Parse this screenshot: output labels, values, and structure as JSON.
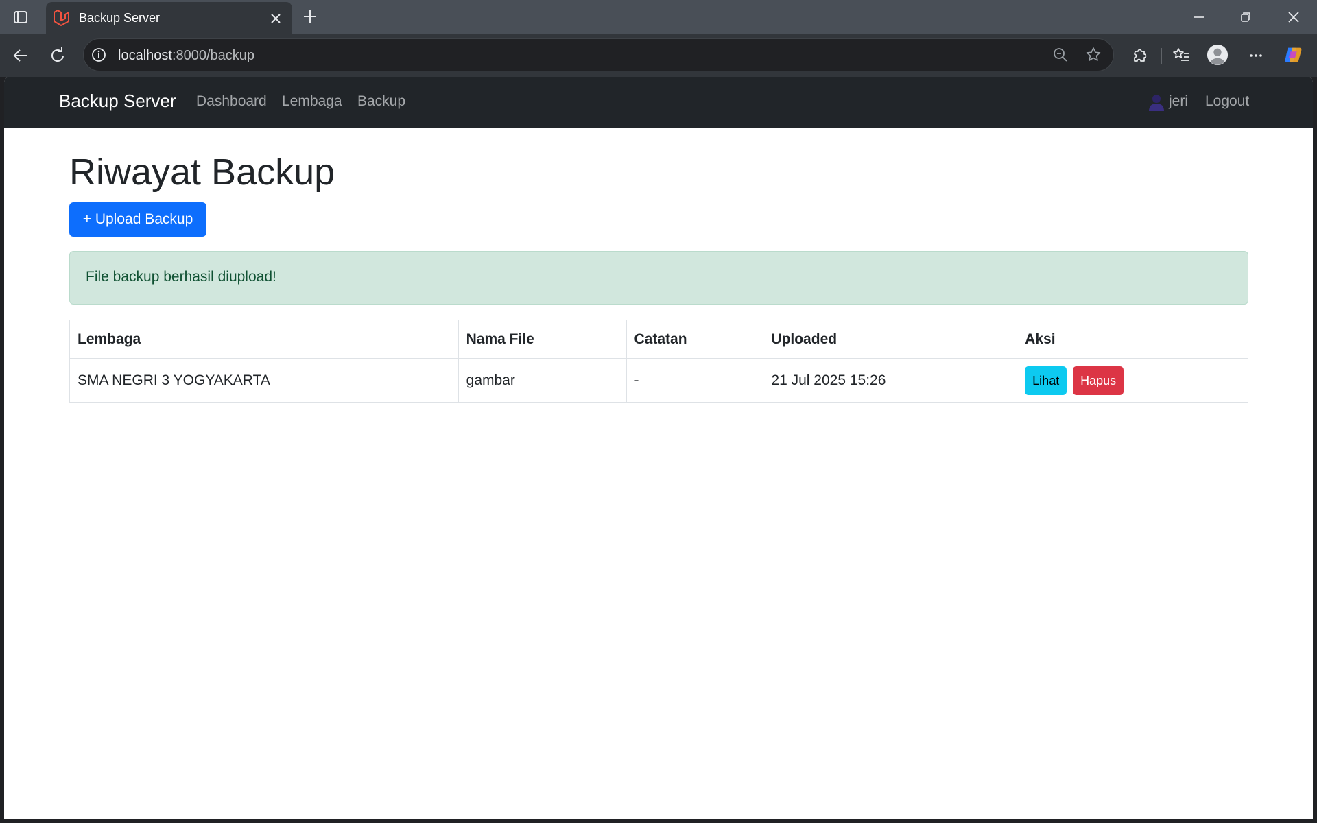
{
  "browser": {
    "tab_title": "Backup Server",
    "url_host": "localhost",
    "url_rest": ":8000/backup"
  },
  "navbar": {
    "brand": "Backup Server",
    "links": [
      "Dashboard",
      "Lembaga",
      "Backup"
    ],
    "user": "jeri",
    "logout": "Logout"
  },
  "page": {
    "title": "Riwayat Backup",
    "upload_button": "+ Upload Backup",
    "alert": "File backup berhasil diupload!"
  },
  "table": {
    "headers": [
      "Lembaga",
      "Nama File",
      "Catatan",
      "Uploaded",
      "Aksi"
    ],
    "rows": [
      {
        "lembaga": "SMA NEGRI 3 YOGYAKARTA",
        "nama_file": "gambar",
        "catatan": "-",
        "uploaded": "21 Jul 2025 15:26",
        "view_label": "Lihat",
        "delete_label": "Hapus"
      }
    ]
  },
  "colors": {
    "primary": "#0d6efd",
    "info": "#0dcaf0",
    "danger": "#dc3545",
    "success_bg": "#d1e7dd",
    "navbar_bg": "#212529"
  }
}
